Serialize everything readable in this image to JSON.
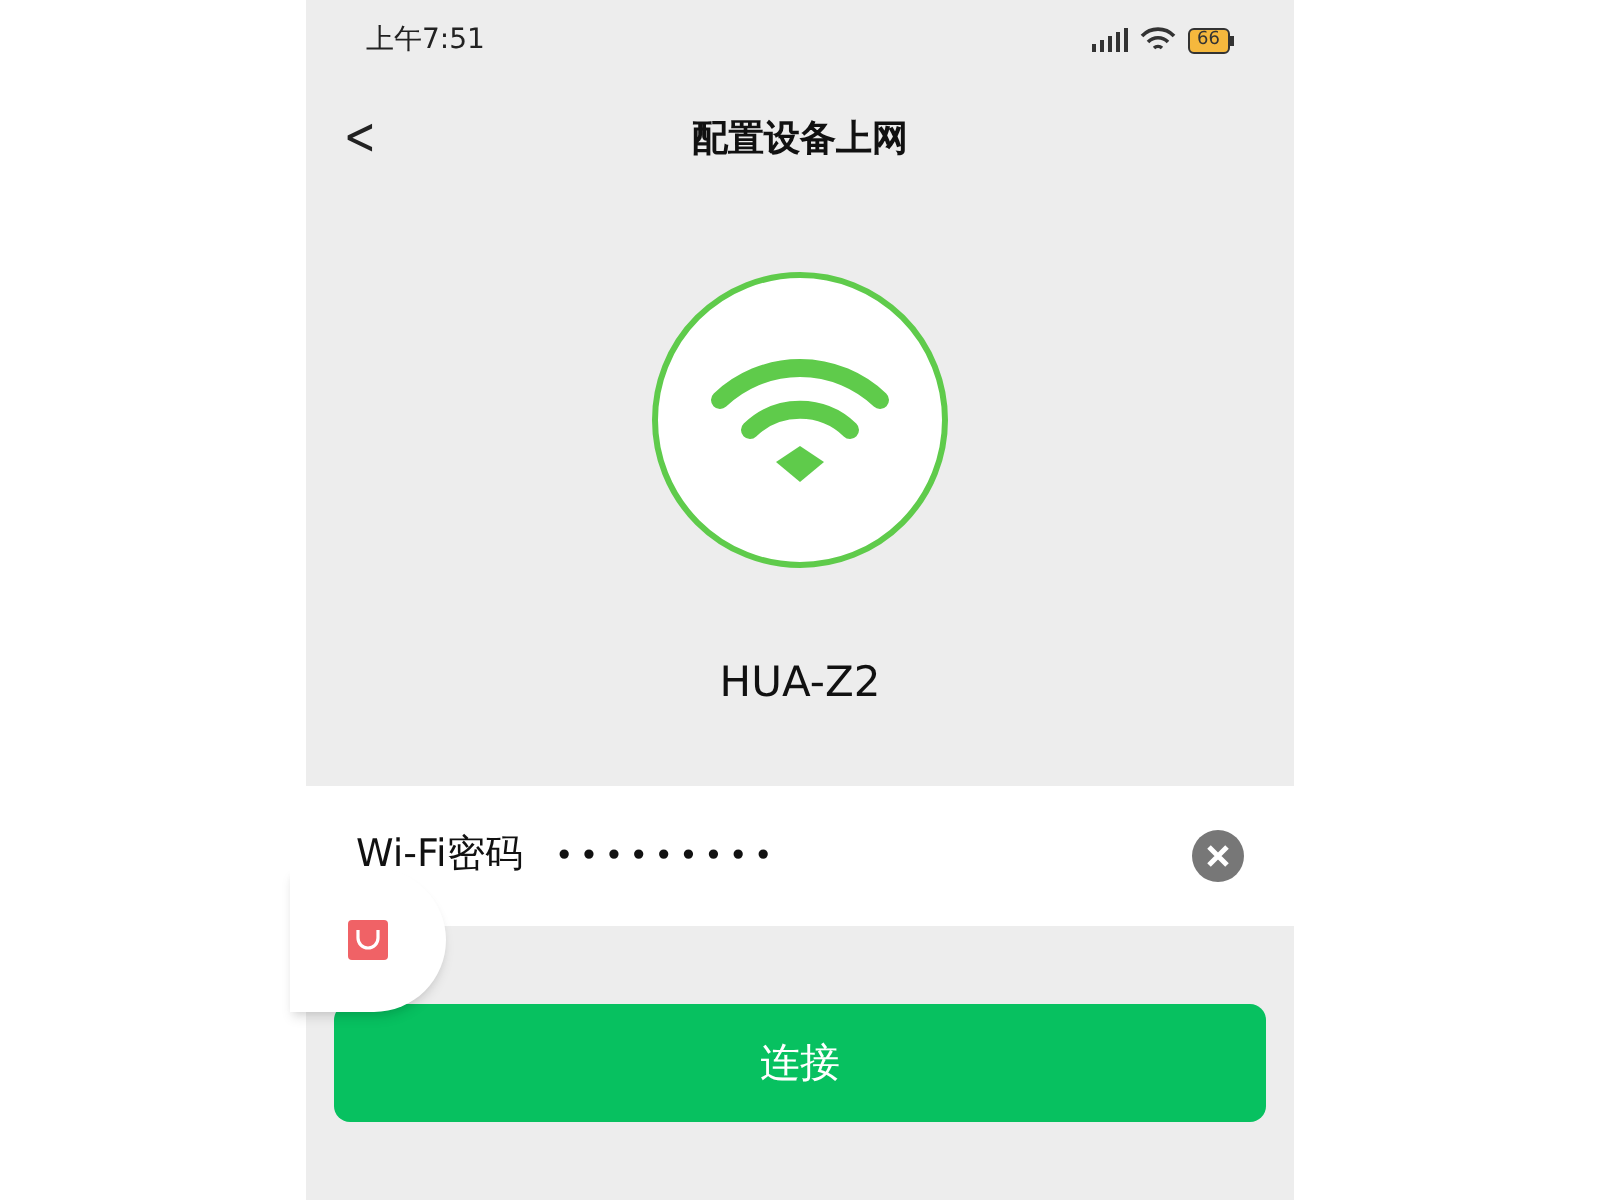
{
  "status_bar": {
    "time": "上午7:51",
    "battery": "66"
  },
  "nav": {
    "back": "<",
    "title": "配置设备上网"
  },
  "device": {
    "name": "HUA-Z2"
  },
  "password_field": {
    "label": "Wi-Fi密码",
    "value": "•••••••••"
  },
  "connect_button": {
    "label": "连接"
  }
}
